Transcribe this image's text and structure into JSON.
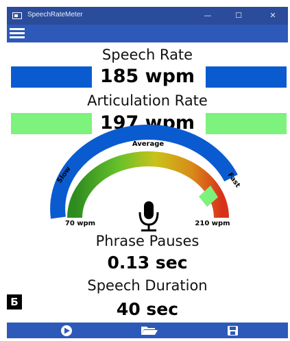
{
  "window": {
    "title": "SpeechRateMeter",
    "minimize": "—",
    "maximize": "☐",
    "close": "✕"
  },
  "speech_rate": {
    "label": "Speech Rate",
    "value": "185 wpm",
    "bar_color": "#0b5bd0"
  },
  "articulation_rate": {
    "label": "Articulation Rate",
    "value": "197 wpm",
    "bar_color": "#7df27d"
  },
  "gauge": {
    "label_average": "Average",
    "label_slow": "Slow",
    "label_fast": "Fast",
    "label_min": "70 wpm",
    "label_max": "210 wpm",
    "min": 70,
    "max": 210,
    "value": 197,
    "outer_color": "#0b5bd0",
    "gradient": [
      "#2e8b1f",
      "#66c12a",
      "#c9c21a",
      "#d98b19",
      "#d8331a"
    ]
  },
  "phrase_pauses": {
    "label": "Phrase Pauses",
    "value": "0.13 sec"
  },
  "speech_duration": {
    "label": "Speech Duration",
    "value": "40 sec"
  },
  "badge": "Б",
  "colors": {
    "accent": "#2d5ab8",
    "titlebar": "#2b4c9a"
  },
  "footer": {
    "icons": [
      "play-icon",
      "folder-open-icon",
      "save-icon"
    ]
  }
}
